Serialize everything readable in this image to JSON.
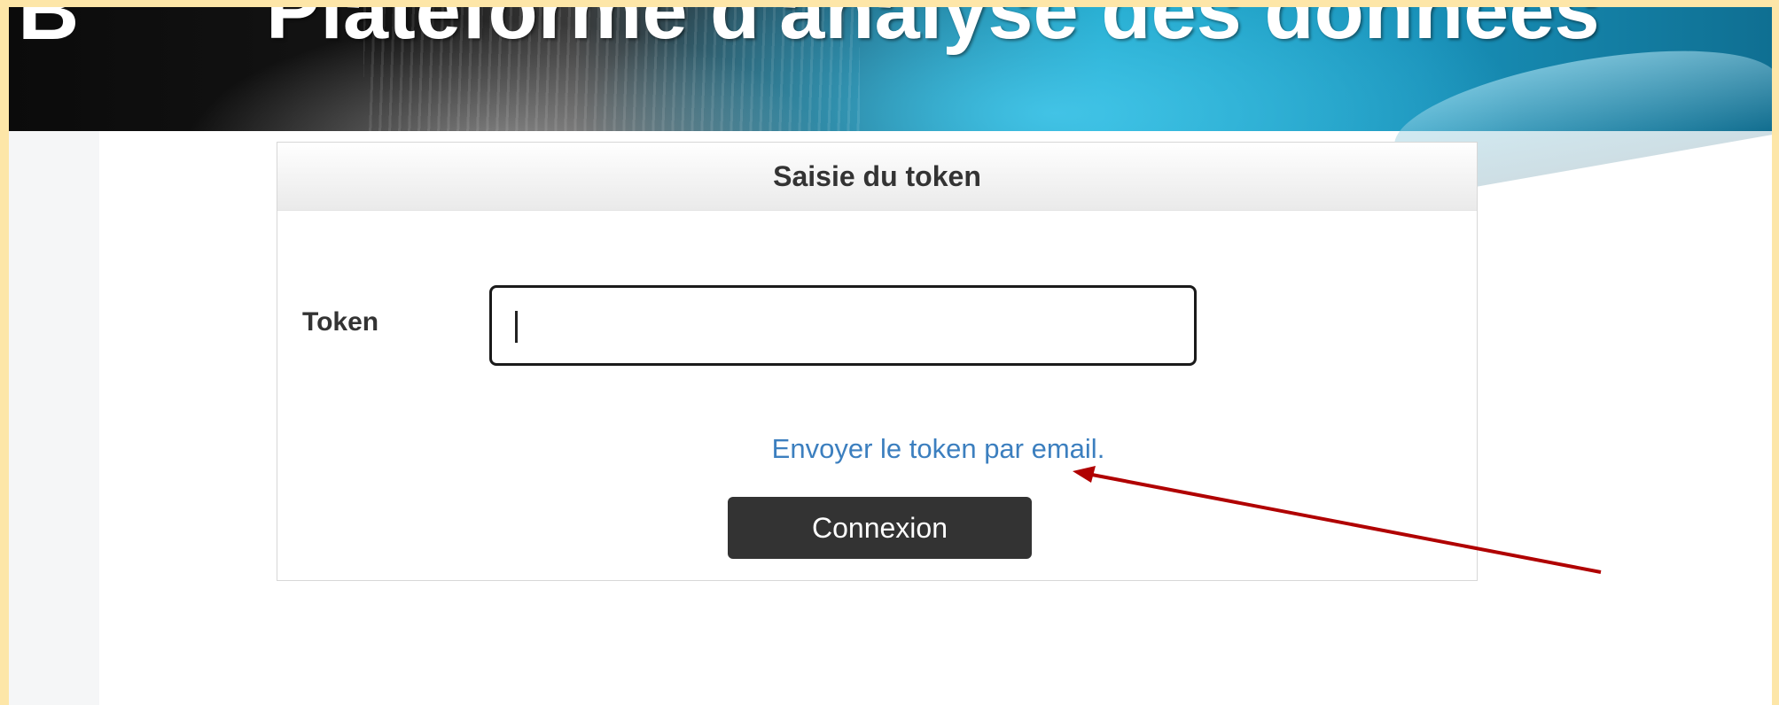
{
  "banner": {
    "logo_text": "B",
    "title": "Plateforme d'analyse des données"
  },
  "login_card": {
    "title": "Saisie du token",
    "token_label": "Token",
    "token_value": "",
    "email_link": "Envoyer le token par email.",
    "submit_label": "Connexion"
  },
  "annotation": {
    "arrow_color": "#b00000"
  },
  "colors": {
    "link": "#3c7fbf",
    "button_bg": "#333333",
    "frame": "#fde6a8"
  }
}
